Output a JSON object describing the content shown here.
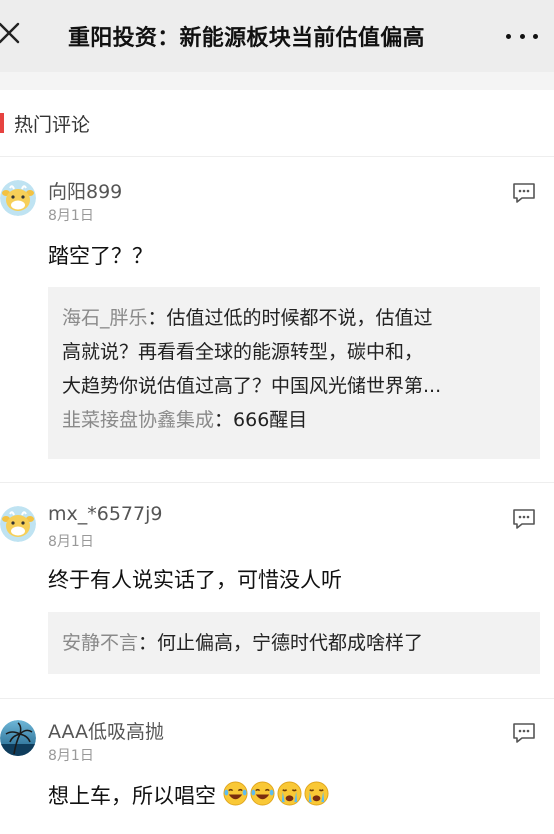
{
  "header": {
    "title": "重阳投资：新能源板块当前估值偏高"
  },
  "section": {
    "title": "热门评论"
  },
  "comments": [
    {
      "username": "向阳899",
      "date": "8月1日",
      "content": "踏空了？？",
      "replies": [
        {
          "name": "海石_胖乐",
          "sep": "：",
          "lines": [
            "估值过低的时候都不说，估值过",
            "高就说？再看看全球的能源转型，碳中和，",
            "大趋势你说估值过高了？中国风光储世界第..."
          ]
        },
        {
          "name": "韭菜接盘协鑫集成",
          "sep": "：",
          "lines": [
            "666醒目"
          ]
        }
      ]
    },
    {
      "username": "mx_*6577j9",
      "date": "8月1日",
      "content": "终于有人说实话了，可惜没人听",
      "replies": [
        {
          "name": "安静不言",
          "sep": "：",
          "lines": [
            "何止偏高，宁德时代都成啥样了"
          ]
        }
      ]
    },
    {
      "username": "AAA低吸高抛",
      "date": "8月1日",
      "content": "想上车，所以唱空",
      "emojis": [
        "tears-of-joy",
        "tears-of-joy",
        "crying",
        "crying"
      ]
    }
  ],
  "colors": {
    "accent_red": "#e64340",
    "topbar_bg": "#ededed",
    "reply_bg": "#f2f2f2",
    "reply_name": "#8a8a8a"
  },
  "icons": {
    "close": "close-icon",
    "more": "more-icon",
    "reply": "comment-reply-icon"
  }
}
